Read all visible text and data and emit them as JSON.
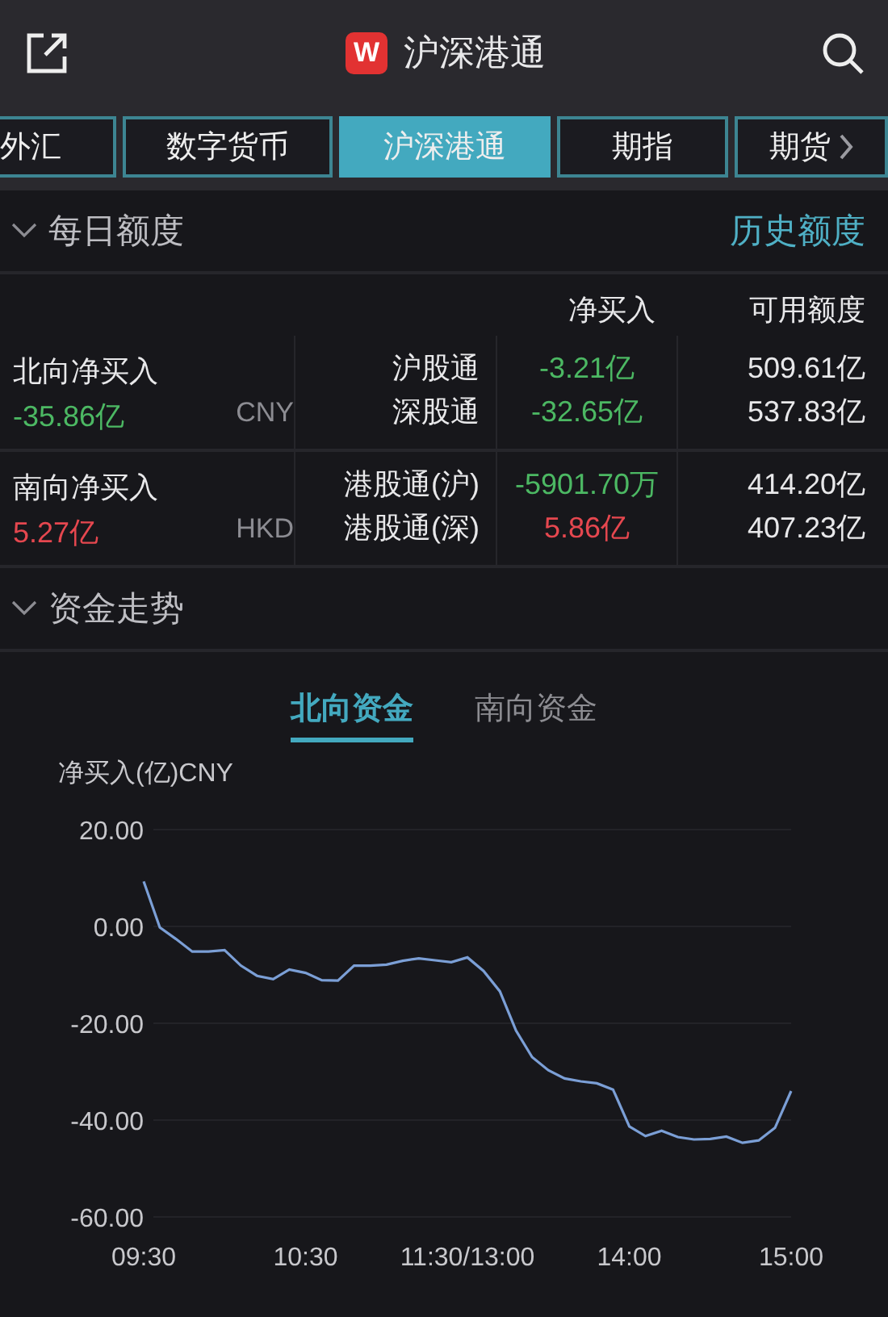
{
  "header": {
    "logo": "W",
    "title": "沪深港通"
  },
  "tabs": [
    {
      "label": "外汇",
      "selected": false
    },
    {
      "label": "数字货币",
      "selected": false
    },
    {
      "label": "沪深港通",
      "selected": true
    },
    {
      "label": "期指",
      "selected": false
    },
    {
      "label": "期货",
      "selected": false
    }
  ],
  "daily_quota": {
    "title": "每日额度",
    "expanded": true,
    "history_link": "历史额度",
    "columns": [
      "净买入",
      "可用额度"
    ],
    "groups": [
      {
        "label": "北向净买入",
        "value": "-35.86亿",
        "color": "#4cb863",
        "currency": "CNY",
        "channels": [
          {
            "name": "沪股通",
            "net": "-3.21亿",
            "color": "#4cb863",
            "available": "509.61亿"
          },
          {
            "name": "深股通",
            "net": "-32.65亿",
            "color": "#4cb863",
            "available": "537.83亿"
          }
        ]
      },
      {
        "label": "南向净买入",
        "value": "5.27亿",
        "color": "#e5474f",
        "currency": "HKD",
        "channels": [
          {
            "name": "港股通(沪)",
            "net": "-5901.70万",
            "color": "#4cb863",
            "available": "414.20亿"
          },
          {
            "name": "港股通(深)",
            "net": "5.86亿",
            "color": "#e5474f",
            "available": "407.23亿"
          }
        ]
      }
    ]
  },
  "fund_trend": {
    "title": "资金走势",
    "expanded": true,
    "tabs": [
      {
        "label": "北向资金",
        "selected": true
      },
      {
        "label": "南向资金",
        "selected": false
      }
    ],
    "chart_data": {
      "type": "line",
      "ylabel": "净买入(亿)CNY",
      "categories": [
        "09:30",
        null,
        null,
        null,
        null,
        null,
        null,
        null,
        null,
        null,
        "10:30",
        null,
        null,
        null,
        null,
        null,
        null,
        null,
        null,
        null,
        "11:30/13:00",
        null,
        null,
        null,
        null,
        null,
        null,
        null,
        null,
        null,
        "14:00",
        null,
        null,
        null,
        null,
        null,
        null,
        null,
        null,
        null,
        "15:00"
      ],
      "series": [
        {
          "color": "#7b9fd6",
          "values": [
            9.3,
            -0.2,
            -2.6,
            -5.2,
            -5.2,
            -4.9,
            -8.1,
            -10.2,
            -10.9,
            -8.9,
            -9.6,
            -11.1,
            -11.2,
            -8.1,
            -8.1,
            -7.9,
            -7.1,
            -6.6,
            -7.0,
            -7.4,
            -6.4,
            -9.2,
            -13.4,
            -21.5,
            -27.0,
            -29.7,
            -31.4,
            -32,
            -32.4,
            -33.7,
            -41.3,
            -43.3,
            -42.2,
            -43.5,
            -44,
            -43.9,
            -43.4,
            -44.7,
            -44.2,
            -41.6,
            -34
          ]
        }
      ],
      "ylim": [
        -60,
        20
      ],
      "grid": true,
      "yticks": [
        {
          "value": 20,
          "label": "20.00"
        },
        {
          "value": 0,
          "label": "0.00"
        },
        {
          "value": -20,
          "label": "-20.00"
        },
        {
          "value": -40,
          "label": "-40.00"
        },
        {
          "value": -60,
          "label": "-60.00"
        }
      ]
    }
  }
}
